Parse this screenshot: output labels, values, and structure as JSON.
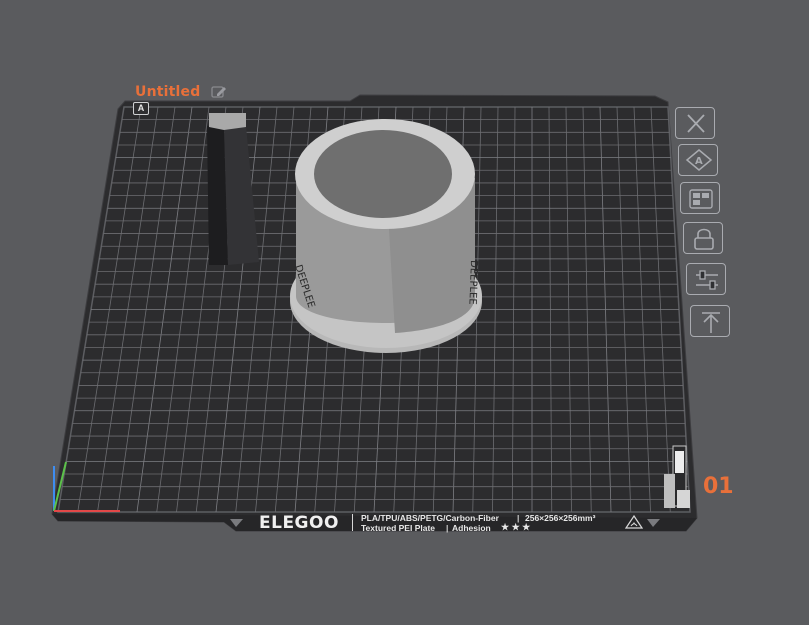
{
  "plate": {
    "title": "Untitled",
    "badge": "A",
    "number": "01",
    "object_label": "DEEPLEE"
  },
  "toolbar": {
    "items": [
      {
        "name": "delete-plate",
        "icon": "close-icon"
      },
      {
        "name": "auto-arrange",
        "icon": "auto-arrange-icon"
      },
      {
        "name": "plate-settings",
        "icon": "plate-settings-icon"
      },
      {
        "name": "lock-plate",
        "icon": "lock-icon"
      },
      {
        "name": "plate-parameters",
        "icon": "sliders-icon"
      },
      {
        "name": "move-to-top",
        "icon": "move-up-icon"
      }
    ]
  },
  "bed": {
    "brand": "ELEGOO",
    "materials": "PLA/TPU/ABS/PETG/Carbon-Fiber",
    "size": "256×256×256mm³",
    "plate_type": "Textured PEI Plate",
    "adhesion_label": "Adhesion",
    "adhesion_rating": "★ ★ ★"
  },
  "colors": {
    "background": "#5a5b5e",
    "bed": "#2c2c2e",
    "accent": "#e8703a",
    "model": "#a3a3a3"
  }
}
